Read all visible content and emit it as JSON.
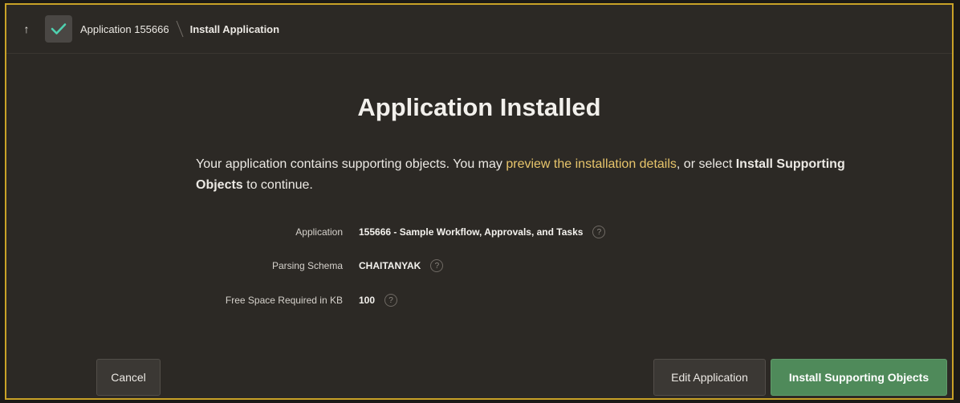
{
  "breadcrumb": {
    "parent": "Application 155666",
    "current": "Install Application"
  },
  "title": "Application Installed",
  "message": {
    "part1": "Your application contains supporting objects. You may ",
    "link": "preview the installation details",
    "part2": ", or select ",
    "bold": "Install Supporting Objects",
    "part3": " to continue."
  },
  "fields": [
    {
      "label": "Application",
      "value": "155666 - Sample Workflow, Approvals, and Tasks"
    },
    {
      "label": "Parsing Schema",
      "value": "CHAITANYAK"
    },
    {
      "label": "Free Space Required in KB",
      "value": "100"
    }
  ],
  "help_glyph": "?",
  "buttons": {
    "cancel": "Cancel",
    "edit": "Edit Application",
    "install": "Install Supporting Objects"
  },
  "colors": {
    "accent_border": "#c9a227",
    "link": "#e8c56b",
    "primary_button": "#4f8a5a",
    "check": "#4fd1b0"
  },
  "icons": {
    "up": "arrow-up-icon",
    "status": "checkmark-icon",
    "help": "help-icon"
  }
}
